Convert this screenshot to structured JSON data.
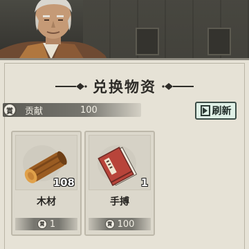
{
  "panel": {
    "title": "兑换物资"
  },
  "currency": {
    "icon": "coin-icon",
    "icon_glyph": "賞",
    "name": "贡献",
    "amount": "100"
  },
  "refresh_button": {
    "label": "刷新"
  },
  "items": [
    {
      "name": "木材",
      "quantity": "108",
      "price": "1",
      "icon": "wood-log-icon"
    },
    {
      "name": "手搏",
      "quantity": "1",
      "price": "100",
      "icon": "manual-book-icon"
    }
  ],
  "colors": {
    "panel_bg": "#e6e2d6",
    "refresh_bg": "#dff0e6",
    "bar_dark": "#5c5b55"
  }
}
